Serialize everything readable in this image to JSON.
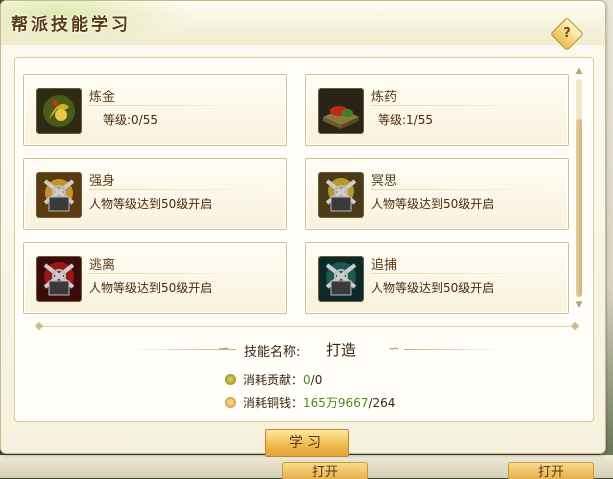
{
  "window": {
    "title": "帮派技能学习",
    "help_label": "?"
  },
  "skills": [
    {
      "name": "炼金",
      "desc": "等级:0/55",
      "icon": "alchemy-icon"
    },
    {
      "name": "炼药",
      "desc": "等级:1/55",
      "icon": "medicine-icon"
    },
    {
      "name": "强身",
      "desc": "人物等级达到50级开启",
      "icon": "locked-skill-icon"
    },
    {
      "name": "冥思",
      "desc": "人物等级达到50级开启",
      "icon": "locked-skill-icon"
    },
    {
      "name": "逃离",
      "desc": "人物等级达到50级开启",
      "icon": "locked-skill-icon"
    },
    {
      "name": "追捕",
      "desc": "人物等级达到50级开启",
      "icon": "locked-skill-icon"
    }
  ],
  "detail": {
    "skill_label": "技能名称:",
    "skill_value": "打造",
    "contribution_label": "消耗贡献：",
    "contribution_used": "0",
    "contribution_total": "/0",
    "money_label": "消耗铜钱：",
    "money_used": "165万9667",
    "money_total": "/264"
  },
  "actions": {
    "learn": "学习"
  },
  "background_buttons": [
    "打开",
    "打开"
  ],
  "colors": {
    "accent": "#f0bd53",
    "value_green": "#4f8a1c",
    "text_brown": "#5b3b15"
  }
}
